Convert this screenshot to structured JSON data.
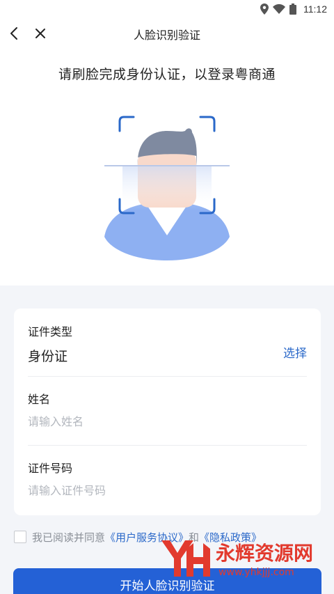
{
  "status_bar": {
    "time": "11:12",
    "icons": [
      "location-icon",
      "wifi-icon",
      "battery-icon"
    ]
  },
  "nav": {
    "title": "人脸识别验证",
    "back_icon": "chevron-left-icon",
    "close_icon": "close-icon"
  },
  "subtitle": "请刷脸完成身份认证，以登录粤商通",
  "form": {
    "id_type": {
      "label": "证件类型",
      "value": "身份证",
      "action": "选择"
    },
    "name": {
      "label": "姓名",
      "placeholder": "请输入姓名"
    },
    "id_number": {
      "label": "证件号码",
      "placeholder": "请输入证件号码"
    }
  },
  "agreement": {
    "prefix": "我已阅读并同意",
    "terms": "《用户服务协议》",
    "conjunction": "和",
    "privacy": "《隐私政策》"
  },
  "start_button": "开始人脸识别验证",
  "watermark": {
    "brand": "永辉资源网",
    "url": "www.yhkjjj.com"
  },
  "colors": {
    "accent": "#2461d6",
    "link": "#2a68c9",
    "page_background": "#f3f5f9",
    "illustration_body": "#8eb0f2",
    "illustration_hair": "#7f8aa0",
    "watermark_red": "#e23a2e"
  }
}
